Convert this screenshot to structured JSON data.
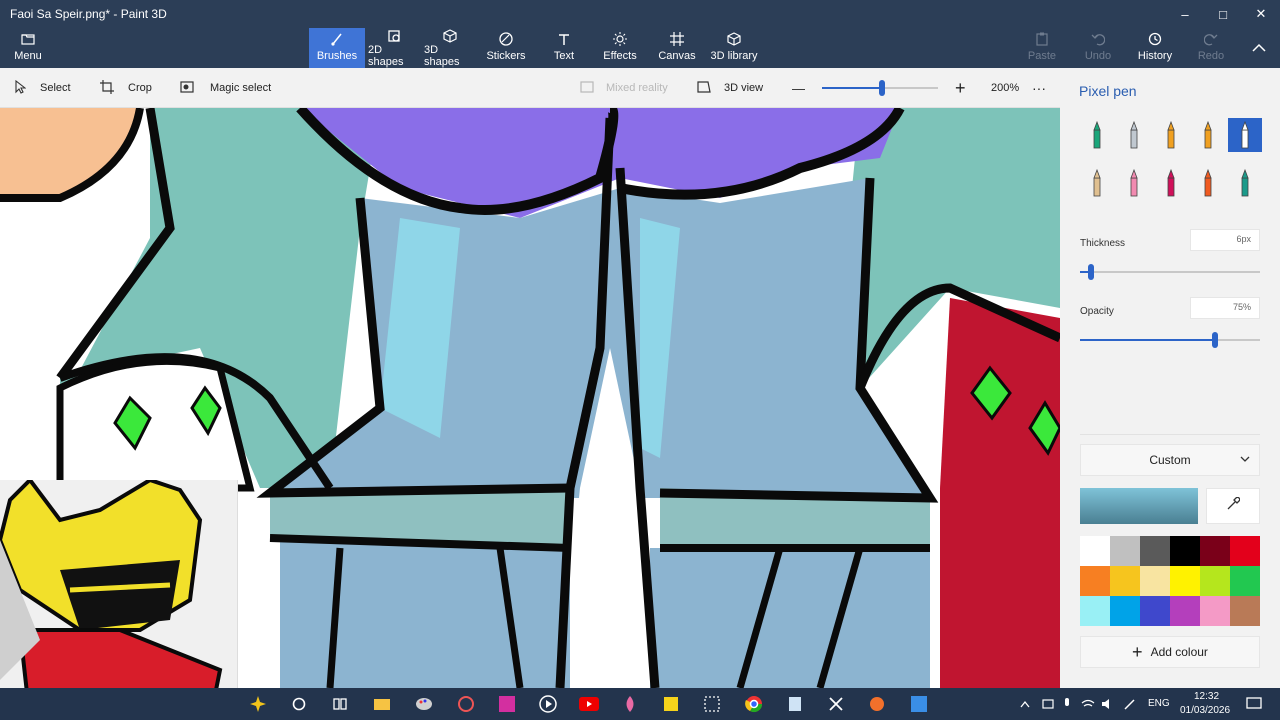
{
  "window": {
    "title": "Faoi Sa Speir.png* - Paint 3D",
    "minimize": "–",
    "maximize": "□",
    "close": "✕"
  },
  "ribbon": {
    "menu_label": "Menu",
    "tabs": [
      {
        "label": "Brushes",
        "icon": "brush-icon",
        "active": true
      },
      {
        "label": "2D shapes",
        "icon": "2d-shapes-icon"
      },
      {
        "label": "3D shapes",
        "icon": "3d-shapes-icon"
      },
      {
        "label": "Stickers",
        "icon": "stickers-icon"
      },
      {
        "label": "Text",
        "icon": "text-icon"
      },
      {
        "label": "Effects",
        "icon": "effects-icon"
      },
      {
        "label": "Canvas",
        "icon": "canvas-icon"
      },
      {
        "label": "3D library",
        "icon": "3d-library-icon"
      }
    ],
    "paste_label": "Paste",
    "undo_label": "Undo",
    "history_label": "History",
    "redo_label": "Redo"
  },
  "toolbar": {
    "select_label": "Select",
    "crop_label": "Crop",
    "magic_select_label": "Magic select",
    "mixed_reality_label": "Mixed reality",
    "view3d_label": "3D view",
    "zoom_minus": "—",
    "zoom_plus": "+",
    "zoom_level": "200%",
    "zoom_fraction": 0.52,
    "more": "···"
  },
  "panel": {
    "title": "Pixel pen",
    "brushes": [
      {
        "name": "marker-icon",
        "color": "#1aa67a"
      },
      {
        "name": "calligraphy-pen-icon",
        "color": "#c0c8d0"
      },
      {
        "name": "oil-brush-icon",
        "color": "#f0a020"
      },
      {
        "name": "watercolor-icon",
        "color": "#f0a020"
      },
      {
        "name": "pixel-pen-icon",
        "color": "#ffffff",
        "selected": true
      },
      {
        "name": "pencil-icon",
        "color": "#e0c090"
      },
      {
        "name": "eraser-icon",
        "color": "#f28ab0"
      },
      {
        "name": "crayon-icon",
        "color": "#d0105a"
      },
      {
        "name": "spray-can-icon",
        "color": "#f05a20"
      },
      {
        "name": "fill-icon",
        "color": "#1b9a8a"
      }
    ],
    "thickness_label": "Thickness",
    "thickness_value": "6px",
    "thickness_fraction": 0.06,
    "opacity_label": "Opacity",
    "opacity_value": "75%",
    "opacity_fraction": 0.75,
    "colour_mode": "Custom",
    "current_colour": "#7fc3d8",
    "swatches": [
      "#ffffff",
      "#c0c0c0",
      "#5a5a5a",
      "#000000",
      "#7a0019",
      "#e3001b",
      "#f77f22",
      "#f6c51e",
      "#f8e4a1",
      "#fff200",
      "#b5e61d",
      "#22c850",
      "#99f0f5",
      "#00a3e8",
      "#3f48cc",
      "#b43fbc",
      "#f49ac6",
      "#b97a57"
    ],
    "add_colour_label": "Add colour"
  },
  "taskbar": {
    "language": "ENG",
    "time": "12:32",
    "date": "01/03/2026"
  }
}
